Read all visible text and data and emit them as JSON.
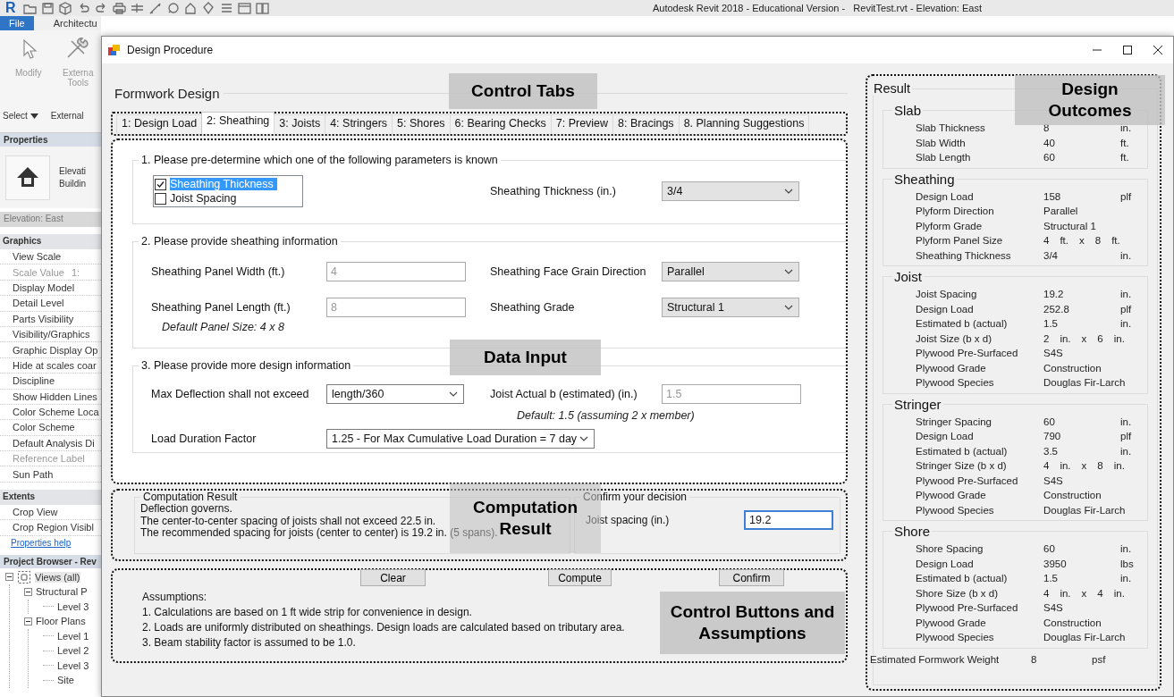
{
  "revit": {
    "logo": "R",
    "title": "Autodesk Revit 2018 - Educational Version -   RevitTest.rvt - Elevation: East",
    "ribbon_tabs": [
      {
        "label": "File",
        "selected": true
      },
      {
        "label": "Architectu",
        "selected": false
      }
    ],
    "tools": [
      {
        "kind": "modify",
        "lines": [
          "Modify"
        ]
      },
      {
        "kind": "external",
        "lines": [
          "Externa",
          "Tools"
        ]
      }
    ],
    "panel_labels": [
      {
        "label": "Select",
        "dropdown": true
      },
      {
        "label": "External",
        "dropdown": false
      }
    ],
    "properties": {
      "header": "Properties",
      "type_lines": [
        "Elevati",
        "Buildin"
      ],
      "instance": "Elevation: East",
      "groups": [
        {
          "name": "Graphics",
          "items": [
            {
              "label": "View Scale",
              "disabled": false
            },
            {
              "label": "Scale Value",
              "value": "1:",
              "disabled": true
            },
            {
              "label": "Display Model",
              "disabled": false
            },
            {
              "label": "Detail Level",
              "disabled": false
            },
            {
              "label": "Parts Visibility",
              "disabled": false
            },
            {
              "label": "Visibility/Graphics",
              "disabled": false
            },
            {
              "label": "Graphic Display Op",
              "disabled": false
            },
            {
              "label": "Hide at scales coar",
              "disabled": false
            },
            {
              "label": "Discipline",
              "disabled": false
            },
            {
              "label": "Show Hidden Lines",
              "disabled": false
            },
            {
              "label": "Color Scheme Loca",
              "disabled": false
            },
            {
              "label": "Color Scheme",
              "disabled": false
            },
            {
              "label": "Default Analysis Di",
              "disabled": false
            },
            {
              "label": "Reference Label",
              "disabled": true
            },
            {
              "label": "Sun Path",
              "disabled": false
            }
          ]
        },
        {
          "name": "Extents",
          "items": [
            {
              "label": "Crop View",
              "disabled": false
            },
            {
              "label": "Crop Region Visibl",
              "disabled": false
            }
          ]
        }
      ],
      "help_link": "Properties help"
    },
    "browser": {
      "header": "Project Browser - Rev",
      "tree": [
        {
          "label": "Views (all)",
          "expanded": true,
          "children": [
            {
              "label": "Structural P",
              "expanded": true,
              "children": [
                {
                  "label": "Level 3"
                }
              ]
            },
            {
              "label": "Floor Plans",
              "expanded": true,
              "children": [
                {
                  "label": "Level 1"
                },
                {
                  "label": "Level 2"
                },
                {
                  "label": "Level 3"
                },
                {
                  "label": "Site"
                }
              ]
            }
          ]
        }
      ]
    }
  },
  "dialog": {
    "title": "Design Procedure",
    "main": {
      "title": "Formwork Design",
      "tabs": [
        {
          "label": "1: Design Load",
          "selected": false
        },
        {
          "label": "2: Sheathing",
          "selected": true
        },
        {
          "label": "3: Joists",
          "selected": false
        },
        {
          "label": "4: Stringers",
          "selected": false
        },
        {
          "label": "5: Shores",
          "selected": false
        },
        {
          "label": "6: Bearing Checks",
          "selected": false
        },
        {
          "label": "7: Preview",
          "selected": false
        },
        {
          "label": "8: Bracings",
          "selected": false
        },
        {
          "label": "8. Planning Suggestions",
          "selected": false
        }
      ],
      "known_parameter": {
        "title": "1. Please pre-determine which one of the following parameters is known",
        "options": [
          {
            "label": "Sheathing Thickness",
            "checked": true,
            "selected": true
          },
          {
            "label": "Joist Spacing",
            "checked": false,
            "selected": false
          }
        ],
        "field": {
          "label": "Sheathing Thickness (in.)",
          "kind": "dropdown",
          "value": "3/4"
        }
      },
      "sheathing_info": {
        "title": "2. Please provide sheathing information",
        "fields": [
          {
            "label": "Sheathing Panel Width (ft.)",
            "kind": "text",
            "value": "4",
            "disabled": true
          },
          {
            "label": "Sheathing Face Grain Direction",
            "kind": "dropdown",
            "value": "Parallel"
          },
          {
            "label": "Sheathing Panel Length (ft.)",
            "kind": "text",
            "value": "8",
            "disabled": true
          },
          {
            "label": "Sheathing Grade",
            "kind": "dropdown",
            "value": "Structural 1"
          }
        ],
        "note": "Default Panel Size: 4 x 8"
      },
      "design_info": {
        "title": "3. Please provide more design information",
        "fields": [
          {
            "label": "Max Deflection shall not exceed",
            "kind": "combo",
            "value": "length/360"
          },
          {
            "label": "Joist Actual b (estimated) (in.)",
            "kind": "text",
            "value": "1.5",
            "disabled": true
          }
        ],
        "note": "Default: 1.5 (assuming 2 x member)",
        "wide_field": {
          "label": "Load Duration Factor",
          "kind": "combo",
          "value": "1.25 - For Max Cumulative Load Duration = 7 day"
        }
      },
      "computation": {
        "title": "Computation Result",
        "lines": [
          "Deflection  governs.",
          "The center-to-center spacing of joists shall not exceed 22.5 in.",
          "The recommended spacing for joists (center to center) is 19.2 in. (5 spans)."
        ]
      },
      "confirm": {
        "title": "Confirm your decision",
        "field": {
          "label": "Joist spacing (in.)",
          "kind": "text",
          "value": "19.2",
          "disabled": false,
          "focused": true
        }
      },
      "buttons": [
        "Clear",
        "Compute",
        "Confirm"
      ],
      "assumptions": {
        "title": "Assumptions:",
        "items": [
          "1. Calculations are based on 1 ft wide strip for convenience in design.",
          "2. Loads are uniformly distributed on sheathings. Design loads are calculated based on tributary area.",
          "3. Beam stability factor is assumed to be 1.0."
        ]
      }
    },
    "result": {
      "title": "Result",
      "groups": [
        {
          "title": "Slab",
          "rows": [
            {
              "kind": "value",
              "label": "Slab Thickness",
              "value": "8",
              "unit": "in."
            },
            {
              "kind": "value",
              "label": "Slab Width",
              "value": "40",
              "unit": "ft."
            },
            {
              "kind": "value",
              "label": "Slab Length",
              "value": "60",
              "unit": "ft."
            }
          ]
        },
        {
          "title": "Sheathing",
          "rows": [
            {
              "kind": "value",
              "label": "Design Load",
              "value": "158",
              "unit": "plf"
            },
            {
              "kind": "value",
              "label": "Plyform Direction",
              "value": "Parallel"
            },
            {
              "kind": "value",
              "label": "Plyform Grade",
              "value": "Structural 1"
            },
            {
              "kind": "size",
              "label": "Plyform Panel Size",
              "parts": [
                "4",
                "ft.",
                "x",
                "8",
                "ft."
              ]
            },
            {
              "kind": "value",
              "label": "Sheathing Thickness",
              "value": "3/4",
              "unit": "in."
            }
          ]
        },
        {
          "title": "Joist",
          "rows": [
            {
              "kind": "value",
              "label": "Joist Spacing",
              "value": "19.2",
              "unit": "in."
            },
            {
              "kind": "value",
              "label": "Design Load",
              "value": "252.8",
              "unit": "plf"
            },
            {
              "kind": "value",
              "label": "Estimated b (actual)",
              "value": "1.5",
              "unit": "in."
            },
            {
              "kind": "size",
              "label": "Joist Size (b x d)",
              "parts": [
                "2",
                "in.",
                "x",
                "6",
                "in."
              ]
            },
            {
              "kind": "value",
              "label": "Plywood Pre-Surfaced",
              "value": "S4S"
            },
            {
              "kind": "value",
              "label": "Plywood Grade",
              "value": "Construction"
            },
            {
              "kind": "value",
              "label": "Plywood Species",
              "value": "Douglas Fir-Larch"
            }
          ]
        },
        {
          "title": "Stringer",
          "rows": [
            {
              "kind": "value",
              "label": "Stringer Spacing",
              "value": "60",
              "unit": "in."
            },
            {
              "kind": "value",
              "label": "Design Load",
              "value": "790",
              "unit": "plf"
            },
            {
              "kind": "value",
              "label": "Estimated b (actual)",
              "value": "3.5",
              "unit": "in."
            },
            {
              "kind": "size",
              "label": "Stringer Size (b x d)",
              "parts": [
                "4",
                "in.",
                "x",
                "8",
                "in."
              ]
            },
            {
              "kind": "value",
              "label": "Plywood Pre-Surfaced",
              "value": "S4S"
            },
            {
              "kind": "value",
              "label": "Plywood Grade",
              "value": "Construction"
            },
            {
              "kind": "value",
              "label": "Plywood Species",
              "value": "Douglas Fir-Larch"
            }
          ]
        },
        {
          "title": "Shore",
          "rows": [
            {
              "kind": "value",
              "label": "Shore Spacing",
              "value": "60",
              "unit": "in."
            },
            {
              "kind": "value",
              "label": "Design Load",
              "value": "3950",
              "unit": "lbs"
            },
            {
              "kind": "value",
              "label": "Estimated b (actual)",
              "value": "1.5",
              "unit": "in."
            },
            {
              "kind": "size",
              "label": "Shore Size (b x d)",
              "parts": [
                "4",
                "in.",
                "x",
                "4",
                "in."
              ]
            },
            {
              "kind": "value",
              "label": "Plywood Pre-Surfaced",
              "value": "S4S"
            },
            {
              "kind": "value",
              "label": "Plywood Grade",
              "value": "Construction"
            },
            {
              "kind": "value",
              "label": "Plywood Species",
              "value": "Douglas Fir-Larch"
            }
          ]
        }
      ],
      "total": {
        "kind": "value",
        "label": "Estimated Formwork Weight",
        "value": "8",
        "unit": "psf"
      }
    }
  },
  "annotations": [
    {
      "text": "Control Tabs"
    },
    {
      "text": "Data Input"
    },
    {
      "text": "Computation Result"
    },
    {
      "text": "Control Buttons and Assumptions"
    },
    {
      "text": "Design Outcomes"
    }
  ]
}
